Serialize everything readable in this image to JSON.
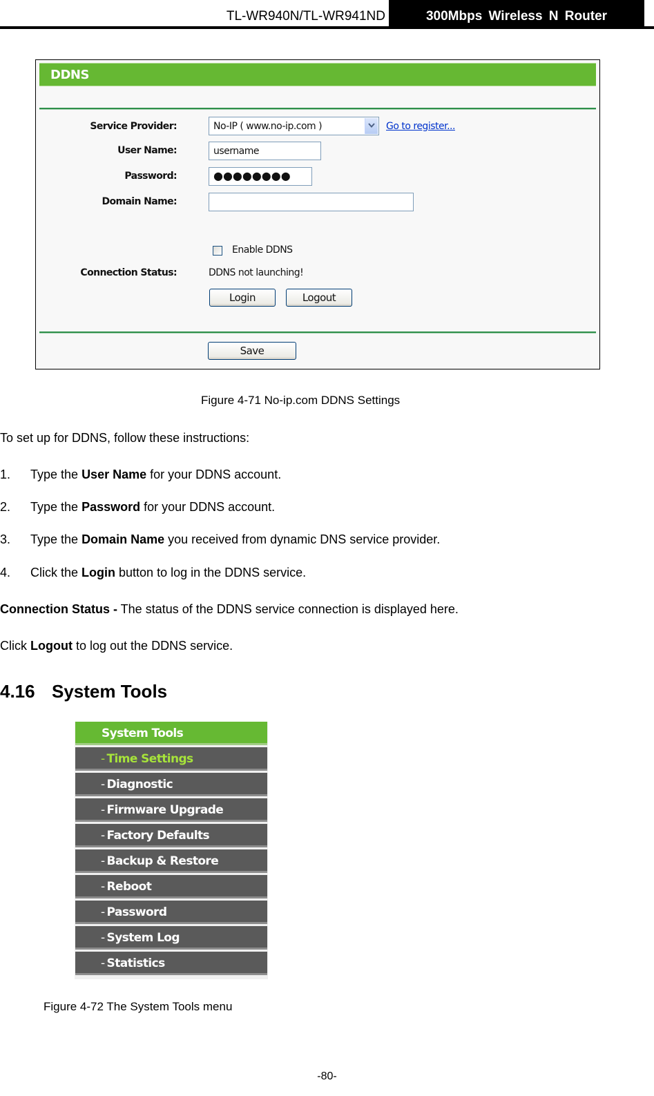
{
  "header": {
    "model": "TL-WR940N/TL-WR941ND",
    "product": "300Mbps  Wireless  N  Router"
  },
  "ddns_panel": {
    "title": "DDNS",
    "labels": {
      "service_provider": "Service Provider:",
      "user_name": "User Name:",
      "password": "Password:",
      "domain_name": "Domain Name:",
      "connection_status": "Connection Status:"
    },
    "service_provider_selected": "No-IP ( www.no-ip.com )",
    "register_link": "Go to register...",
    "user_name_value": "username",
    "password_value": "●●●●●●●●",
    "domain_name_value": "",
    "enable_ddns_label": "Enable DDNS",
    "enable_ddns_checked": false,
    "connection_status_value": "DDNS not launching!",
    "buttons": {
      "login": "Login",
      "logout": "Logout",
      "save": "Save"
    },
    "colors": {
      "title_bar": "#66b833",
      "rule": "#2f8f4a"
    }
  },
  "figure_71_caption": "Figure 4-71 No-ip.com DDNS Settings",
  "intro": "To set up for DDNS, follow these instructions:",
  "steps": [
    {
      "num": "1.",
      "pre": "Type the ",
      "bold": "User Name",
      "post": " for your DDNS account."
    },
    {
      "num": "2.",
      "pre": "Type the ",
      "bold": "Password",
      "post": " for your DDNS account."
    },
    {
      "num": "3.",
      "pre": "Type the ",
      "bold": "Domain Name",
      "post": " you received from dynamic DNS service provider."
    },
    {
      "num": "4.",
      "pre": "Click the ",
      "bold": "Login",
      "post": " button to log in the DDNS service."
    }
  ],
  "connection_status_para": {
    "bold": "Connection Status -",
    "post": " The status of the DDNS service connection is displayed here."
  },
  "logout_para": {
    "pre": "Click ",
    "bold": "Logout",
    "post": " to log out the DDNS service."
  },
  "section": {
    "number": "4.16",
    "title": "System Tools"
  },
  "system_tools_menu": {
    "header": "System Tools",
    "items": [
      {
        "label": "Time Settings",
        "active": true
      },
      {
        "label": "Diagnostic",
        "active": false
      },
      {
        "label": "Firmware Upgrade",
        "active": false
      },
      {
        "label": "Factory Defaults",
        "active": false
      },
      {
        "label": "Backup & Restore",
        "active": false
      },
      {
        "label": "Reboot",
        "active": false
      },
      {
        "label": "Password",
        "active": false
      },
      {
        "label": "System Log",
        "active": false
      },
      {
        "label": "Statistics",
        "active": false
      }
    ],
    "colors": {
      "header": "#66b933",
      "item": "#5a5a5a",
      "active_text": "#a6e33a"
    }
  },
  "figure_72_caption": "Figure 4-72 The System Tools menu",
  "page_number": "-80-"
}
